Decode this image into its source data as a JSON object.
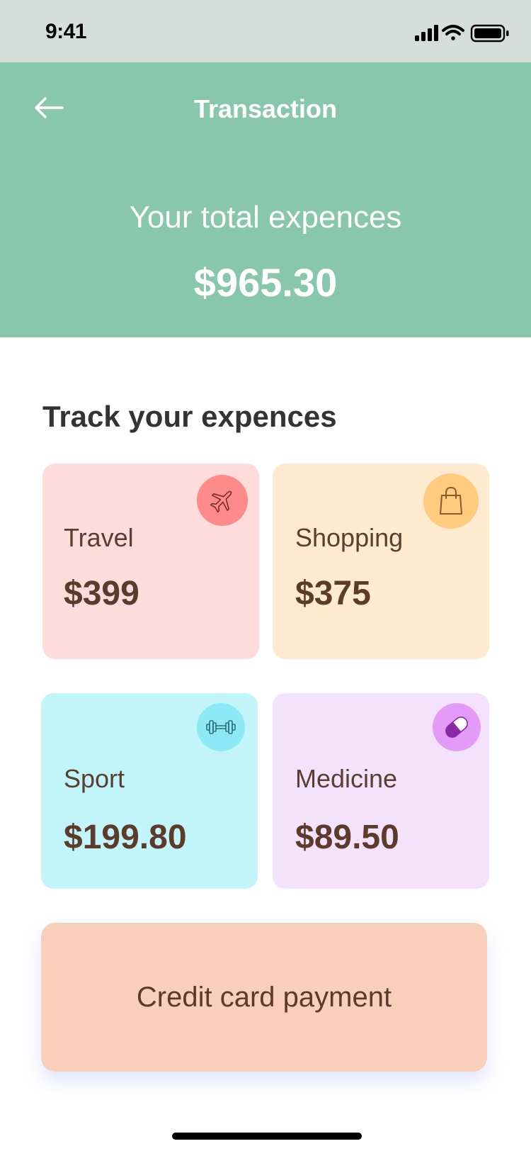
{
  "status_bar": {
    "time": "9:41",
    "icons": [
      "cellular-signal-icon",
      "wifi-icon",
      "battery-icon"
    ]
  },
  "header": {
    "title": "Transaction",
    "back_icon": "arrow-left-icon",
    "total_label": "Your total expences",
    "total_amount": "$965.30",
    "color": "#88c6ae"
  },
  "section": {
    "title": "Track your expences"
  },
  "cards": [
    {
      "label": "Travel",
      "amount": "$399",
      "icon": "airplane-icon",
      "bg": "#ffdcdc",
      "icon_bg": "#ff8a8a"
    },
    {
      "label": "Shopping",
      "amount": "$375",
      "icon": "shopping-bag-icon",
      "bg": "#feeacf",
      "icon_bg": "#ffcb7f"
    },
    {
      "label": "Sport",
      "amount": "$199.80",
      "icon": "dumbbell-icon",
      "bg": "#c2f5fa",
      "icon_bg": "#8ce9f5"
    },
    {
      "label": "Medicine",
      "amount": "$89.50",
      "icon": "pill-icon",
      "bg": "#f4e2fd",
      "icon_bg": "#e39bf7"
    }
  ],
  "cta": {
    "label": "Credit card payment",
    "color": "#f8cfbb"
  }
}
